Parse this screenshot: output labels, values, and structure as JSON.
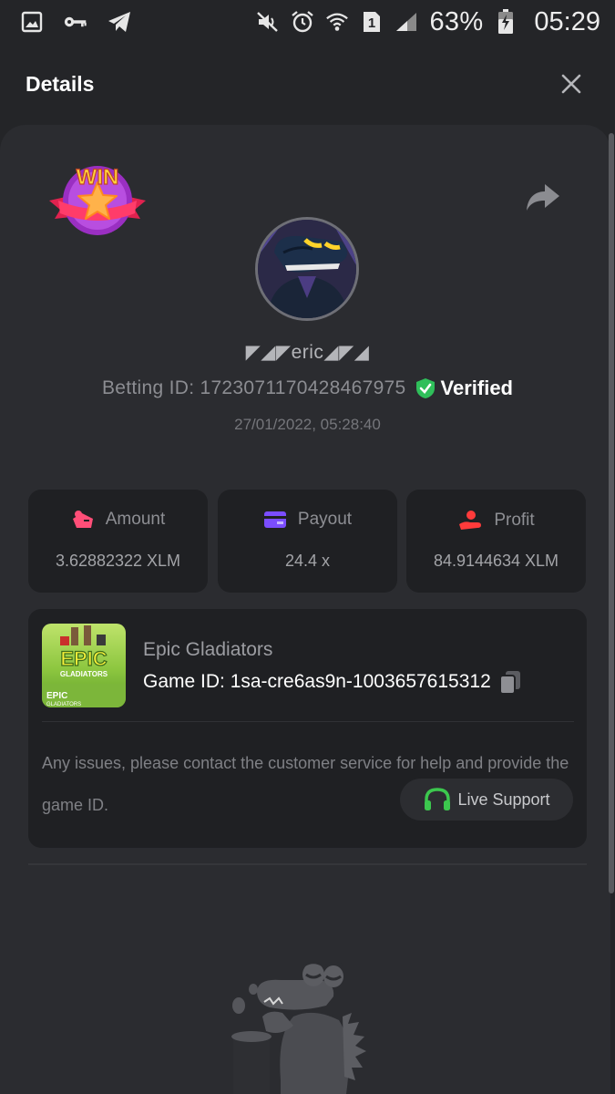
{
  "status_bar": {
    "battery_percent": "63%",
    "time": "05:29",
    "left_icons": [
      "image-icon",
      "key-icon",
      "telegram-icon"
    ],
    "right_icons": [
      "mute-icon",
      "alarm-icon",
      "wifi-icon",
      "sim-icon",
      "signal-icon",
      "battery-icon"
    ],
    "sim_label": "1"
  },
  "header": {
    "title": "Details"
  },
  "player": {
    "username": "◤◢◤eric◢◤◢",
    "betting_id": "Betting ID: 1723071170428467975",
    "verified_label": "Verified",
    "datetime": "27/01/2022, 05:28:40",
    "badge_text": "WIN"
  },
  "stats": [
    {
      "label": "Amount",
      "value": "3.62882322 XLM",
      "icon": "amount-icon",
      "color": "#ff4e78"
    },
    {
      "label": "Payout",
      "value": "24.4 x",
      "icon": "payout-card-icon",
      "color": "#7b4dff"
    },
    {
      "label": "Profit",
      "value": "84.9144634 XLM",
      "icon": "profit-hand-icon",
      "color": "#ff3b3b"
    }
  ],
  "game": {
    "name": "Epic Gladiators",
    "game_id": "Game ID: 1sa-cre6as9n-1003657615312",
    "thumb_title": "EPIC",
    "thumb_subtitle": "GLADIATORS",
    "help_text": "Any issues, please contact the customer service for help and provide the game ID.",
    "support_label": "Live Support"
  },
  "colors": {
    "background": "#242528",
    "panel": "#2b2c30",
    "card": "#1f2023",
    "verified_green": "#2fbf5a",
    "support_green": "#3cc74e"
  }
}
